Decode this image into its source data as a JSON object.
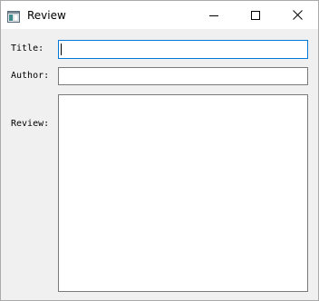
{
  "window": {
    "title": "Review",
    "icon": "app-window-icon",
    "controls": {
      "minimize_icon": "minimize-icon",
      "maximize_icon": "maximize-icon",
      "close_icon": "close-icon"
    }
  },
  "form": {
    "title_label": "Title:",
    "title_value": "",
    "author_label": "Author:",
    "author_value": "",
    "review_label": "Review:",
    "review_value": ""
  },
  "colors": {
    "focus_border": "#0078d7",
    "field_border": "#7a7a7a",
    "background": "#f0f0f0"
  }
}
